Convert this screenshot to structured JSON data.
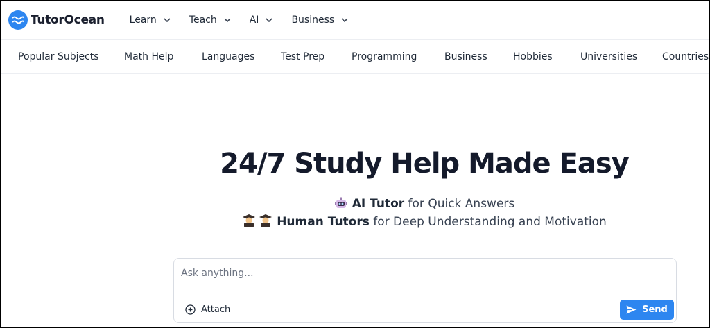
{
  "brand": {
    "name": "TutorOcean",
    "color": "#2d86f0"
  },
  "nav": {
    "items": [
      {
        "label": "Learn"
      },
      {
        "label": "Teach"
      },
      {
        "label": "AI"
      },
      {
        "label": "Business"
      }
    ]
  },
  "categories": [
    "Popular Subjects",
    "Math Help",
    "Languages",
    "Test Prep",
    "Programming",
    "Business",
    "Hobbies",
    "Universities",
    "Countries"
  ],
  "hero": {
    "title": "24/7 Study Help Made Easy",
    "line1": {
      "emoji": "robot-icon",
      "strong": "AI Tutor",
      "rest": "for Quick Answers"
    },
    "line2": {
      "emoji": "graduate-icon",
      "strong": "Human Tutors",
      "rest": "for Deep Understanding and Motivation"
    }
  },
  "ask": {
    "placeholder": "Ask anything...",
    "attach_label": "Attach",
    "send_label": "Send"
  }
}
